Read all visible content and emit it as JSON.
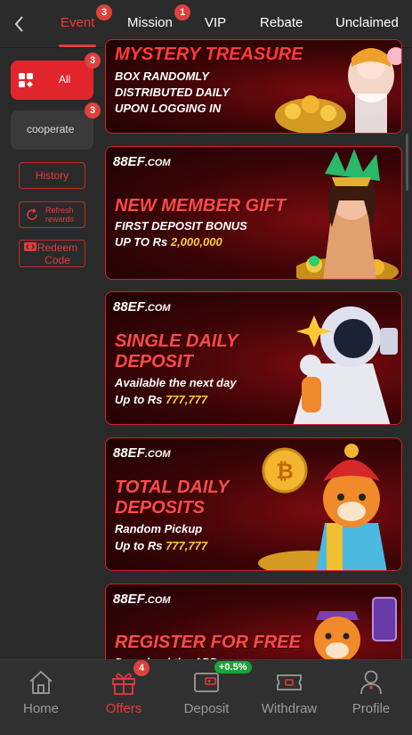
{
  "tabs": [
    {
      "label": "Event",
      "badge": "3",
      "active": true
    },
    {
      "label": "Mission",
      "badge": "1"
    },
    {
      "label": "VIP"
    },
    {
      "label": "Rebate"
    },
    {
      "label": "Unclaimed"
    }
  ],
  "sidebar": {
    "categories": [
      {
        "label": "All",
        "badge": "3"
      },
      {
        "label": "cooperate",
        "badge": "3"
      }
    ],
    "history_label": "History",
    "refresh_label": "Refresh rewards",
    "redeem_label": "Redeem Code"
  },
  "banners": [
    {
      "title_lines": [
        "MYSTERY TREASURE"
      ],
      "lines": [
        "BOX RANDOMLY",
        "DISTRIBUTED DAILY",
        "UPON LOGGING IN"
      ]
    },
    {
      "brand": "88EF",
      "brand_suffix": ".COM",
      "title_lines": [
        "NEW MEMBER GIFT"
      ],
      "line1": "FIRST DEPOSIT BONUS",
      "line2_prefix": "UP TO Rs ",
      "line2_amount": "2,000,000"
    },
    {
      "brand": "88EF",
      "brand_suffix": ".COM",
      "title_lines": [
        "SINGLE DAILY",
        "DEPOSIT"
      ],
      "line1": "Available the next day",
      "line2_prefix": "Up to Rs ",
      "line2_amount": "777,777"
    },
    {
      "brand": "88EF",
      "brand_suffix": ".COM",
      "title_lines": [
        "TOTAL DAILY",
        "DEPOSITS"
      ],
      "line1": "Random Pickup",
      "line2_prefix": "Up to Rs ",
      "line2_amount": "777,777"
    },
    {
      "brand": "88EF",
      "brand_suffix": ".COM",
      "title_lines": [
        "REGISTER FOR FREE"
      ],
      "line1": "Download the APP"
    }
  ],
  "bottom_nav": [
    {
      "label": "Home",
      "icon": "home-icon"
    },
    {
      "label": "Offers",
      "icon": "gift-icon",
      "badge": "4",
      "active": true
    },
    {
      "label": "Deposit",
      "icon": "wallet-icon",
      "tag": "+0.5%"
    },
    {
      "label": "Withdraw",
      "icon": "ticket-icon"
    },
    {
      "label": "Profile",
      "icon": "person-icon"
    }
  ],
  "colors": {
    "accent": "#e53a3a",
    "badge": "#e0413c",
    "tag_green": "#1aa33a",
    "background": "#2a2a2a"
  }
}
